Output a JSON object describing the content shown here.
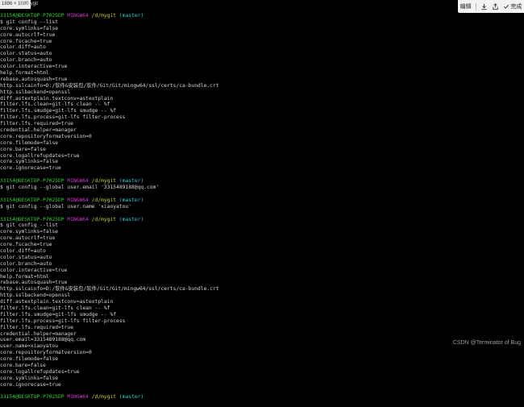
{
  "window": {
    "dimension_badge": "1896 × 1080",
    "title_path": "/d/mygit"
  },
  "toolbar": {
    "edit_label": "编辑",
    "done_label": "完成"
  },
  "colors": {
    "user": "#33cc33",
    "host": "#cc33cc",
    "path": "#cccc33",
    "branch": "#33cccc"
  },
  "terminal": {
    "blocks": [
      {
        "prompt": {
          "user": "33154@DESKTOP-P7025DP",
          "host": "MINGW64",
          "path": "/d/mygit",
          "branch": "(master)"
        },
        "command": "$ git config --list",
        "output": [
          "core.symlinks=false",
          "core.autocrlf=true",
          "core.fscache=true",
          "color.diff=auto",
          "color.status=auto",
          "color.branch=auto",
          "color.interactive=true",
          "help.format=html",
          "rebase.autosquash=true",
          "http.sslcainfo=D:/软件&安装包/软件/Git/Git/mingw64/ssl/certs/ca-bundle.crt",
          "http.sslbackend=openssl",
          "diff.astextplain.textconv=astextplain",
          "filter.lfs.clean=git-lfs clean -- %f",
          "filter.lfs.smudge=git-lfs smudge -- %f",
          "filter.lfs.process=git-lfs filter-process",
          "filter.lfs.required=true",
          "credential.helper=manager",
          "core.repositoryformatversion=0",
          "core.filemode=false",
          "core.bare=false",
          "core.logallrefupdates=true",
          "core.symlinks=false",
          "core.ignorecase=true"
        ]
      },
      {
        "prompt": {
          "user": "33154@DESKTOP-P7025DP",
          "host": "MINGW64",
          "path": "/d/mygit",
          "branch": "(master)"
        },
        "command": "$ git config --global user.email '3315489188@qq.com'",
        "output": []
      },
      {
        "prompt": {
          "user": "33154@DESKTOP-P7025DP",
          "host": "MINGW64",
          "path": "/d/mygit",
          "branch": "(master)"
        },
        "command": "$ git config --global user.name 'xiaoyatou'",
        "output": []
      },
      {
        "prompt": {
          "user": "33154@DESKTOP-P7025DP",
          "host": "MINGW64",
          "path": "/d/mygit",
          "branch": "(master)"
        },
        "command": "$ git config --list",
        "output": [
          "core.symlinks=false",
          "core.autocrlf=true",
          "core.fscache=true",
          "color.diff=auto",
          "color.status=auto",
          "color.branch=auto",
          "color.interactive=true",
          "help.format=html",
          "rebase.autosquash=true",
          "http.sslcainfo=D:/软件&安装包/软件/Git/Git/mingw64/ssl/certs/ca-bundle.crt",
          "http.sslbackend=openssl",
          "diff.astextplain.textconv=astextplain",
          "filter.lfs.clean=git-lfs clean -- %f",
          "filter.lfs.smudge=git-lfs smudge -- %f",
          "filter.lfs.process=git-lfs filter-process",
          "filter.lfs.required=true",
          "credential.helper=manager",
          "user.email=3315489188@qq.com",
          "user.name=xiaoyatou",
          "core.repositoryformatversion=0",
          "core.filemode=false",
          "core.bare=false",
          "core.logallrefupdates=true",
          "core.symlinks=false",
          "core.ignorecase=true"
        ]
      },
      {
        "prompt": {
          "user": "33154@DESKTOP-P7025DP",
          "host": "MINGW64",
          "path": "/d/mygit",
          "branch": "(master)"
        },
        "command": "",
        "output": []
      }
    ]
  },
  "watermark": "CSDN @Terminator of Bug"
}
